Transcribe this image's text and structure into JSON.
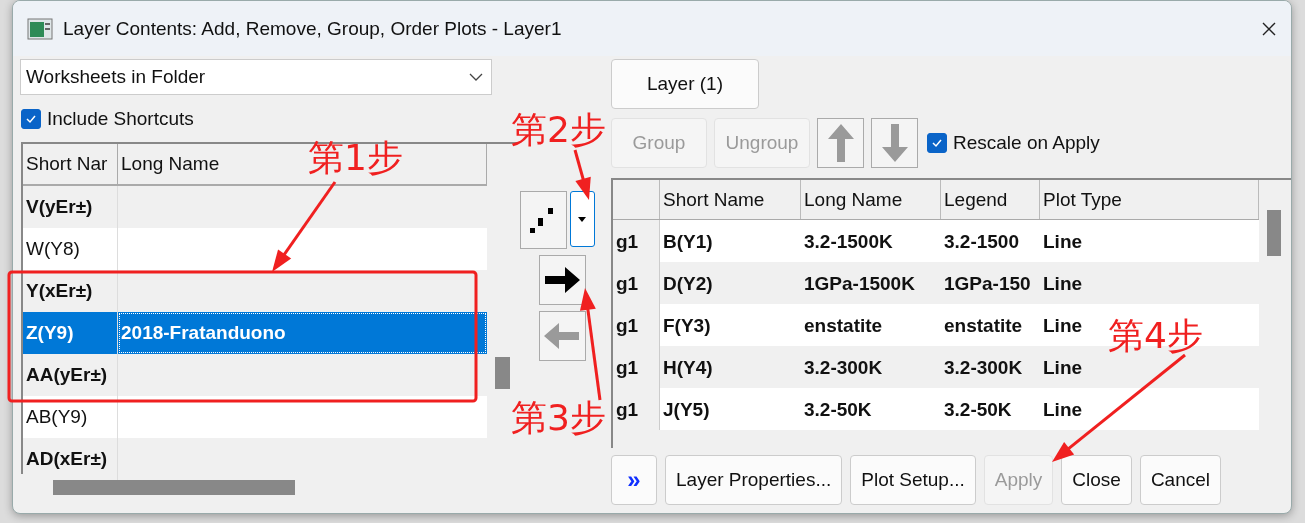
{
  "window": {
    "title": "Layer Contents: Add, Remove, Group, Order Plots - Layer1"
  },
  "source": {
    "value": "Worksheets in Folder"
  },
  "include_shortcuts": {
    "label": "Include Shortcuts",
    "checked": true
  },
  "worksheet_table": {
    "columns": [
      "Short Nar",
      "Long Name"
    ],
    "rows": [
      {
        "short": "V(yEr±)",
        "long": "",
        "kind": "error",
        "selected": false
      },
      {
        "short": "W(Y8)",
        "long": "",
        "kind": "data",
        "selected": false
      },
      {
        "short": "Y(xEr±)",
        "long": "",
        "kind": "error",
        "selected": false
      },
      {
        "short": "Z(Y9)",
        "long": "2018-Fratanduono",
        "kind": "data",
        "selected": true
      },
      {
        "short": "AA(yEr±)",
        "long": "",
        "kind": "error",
        "selected": false
      },
      {
        "short": "AB(Y9)",
        "long": "",
        "kind": "data",
        "selected": false
      },
      {
        "short": "AD(xEr±)",
        "long": "",
        "kind": "error",
        "selected": false
      }
    ]
  },
  "layer_button": {
    "label": "Layer (1)"
  },
  "group_buttons": [
    {
      "label": "Group",
      "disabled": true
    },
    {
      "label": "Ungroup",
      "disabled": true
    }
  ],
  "move_buttons": [
    {
      "kind": "up",
      "disabled": true
    },
    {
      "kind": "down",
      "disabled": true
    }
  ],
  "rescale": {
    "label": "Rescale on Apply",
    "checked": true
  },
  "transfer_buttons": [
    {
      "kind": "right",
      "disabled": false
    },
    {
      "kind": "left",
      "disabled": true
    }
  ],
  "layer_table": {
    "columns": [
      "",
      "Short Name",
      "Long Name",
      "Legend",
      "Plot Type"
    ],
    "rows": [
      [
        "g1",
        "B(Y1)",
        "3.2-1500K",
        "3.2-1500",
        "Line"
      ],
      [
        "g1",
        "D(Y2)",
        "1GPa-1500K",
        "1GPa-150",
        "Line"
      ],
      [
        "g1",
        "F(Y3)",
        "enstatite",
        "enstatite",
        "Line"
      ],
      [
        "g1",
        "H(Y4)",
        "3.2-300K",
        "3.2-300K",
        "Line"
      ],
      [
        "g1",
        "J(Y5)",
        "3.2-50K",
        "3.2-50K",
        "Line"
      ]
    ]
  },
  "bottom_buttons": [
    {
      "label": "»",
      "kind": "expand",
      "disabled": false
    },
    {
      "label": "Layer Properties...",
      "kind": "text",
      "disabled": false
    },
    {
      "label": "Plot Setup...",
      "kind": "text",
      "disabled": false
    },
    {
      "label": "Apply",
      "kind": "text",
      "disabled": true
    },
    {
      "label": "Close",
      "kind": "text",
      "disabled": false
    },
    {
      "label": "Cancel",
      "kind": "text",
      "disabled": false
    }
  ],
  "annotations": [
    {
      "text": "第1步"
    },
    {
      "text": "第2步"
    },
    {
      "text": "第3步"
    },
    {
      "text": "第4步"
    }
  ]
}
